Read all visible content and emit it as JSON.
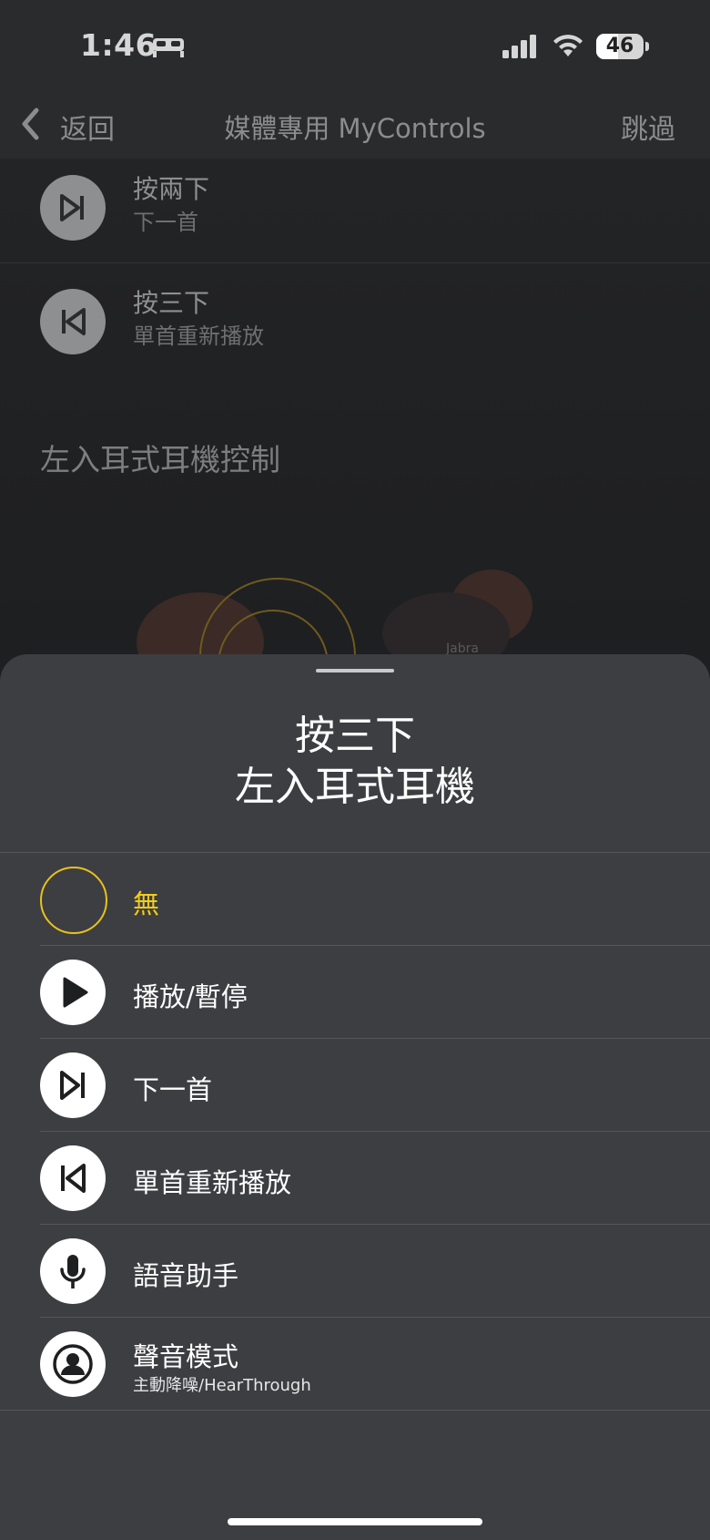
{
  "status_bar": {
    "time": "1:46",
    "battery_percent": "46",
    "icons": [
      "bed-icon",
      "signal-icon",
      "wifi-icon",
      "battery-icon"
    ]
  },
  "nav": {
    "back_label": "返回",
    "title": "媒體專用 MyControls",
    "skip_label": "跳過"
  },
  "background_list": [
    {
      "title": "按兩下",
      "subtitle": "下一首",
      "icon": "next-track-icon"
    },
    {
      "title": "按三下",
      "subtitle": "單首重新播放",
      "icon": "restart-track-icon"
    }
  ],
  "background_section": "左入耳式耳機控制",
  "sheet": {
    "title_line1": "按三下",
    "title_line2": "左入耳式耳機",
    "options": [
      {
        "label": "無",
        "icon": "none-icon",
        "selected": true
      },
      {
        "label": "播放/暫停",
        "icon": "play-icon"
      },
      {
        "label": "下一首",
        "icon": "next-track-icon"
      },
      {
        "label": "單首重新播放",
        "icon": "restart-track-icon"
      },
      {
        "label": "語音助手",
        "icon": "microphone-icon"
      },
      {
        "label": "聲音模式",
        "sublabel": "主動降噪/HearThrough",
        "icon": "sound-mode-icon"
      }
    ]
  },
  "colors": {
    "accent_yellow": "#f2cc1c",
    "sheet_bg": "#3d3e42",
    "background": "#1e1f21"
  }
}
